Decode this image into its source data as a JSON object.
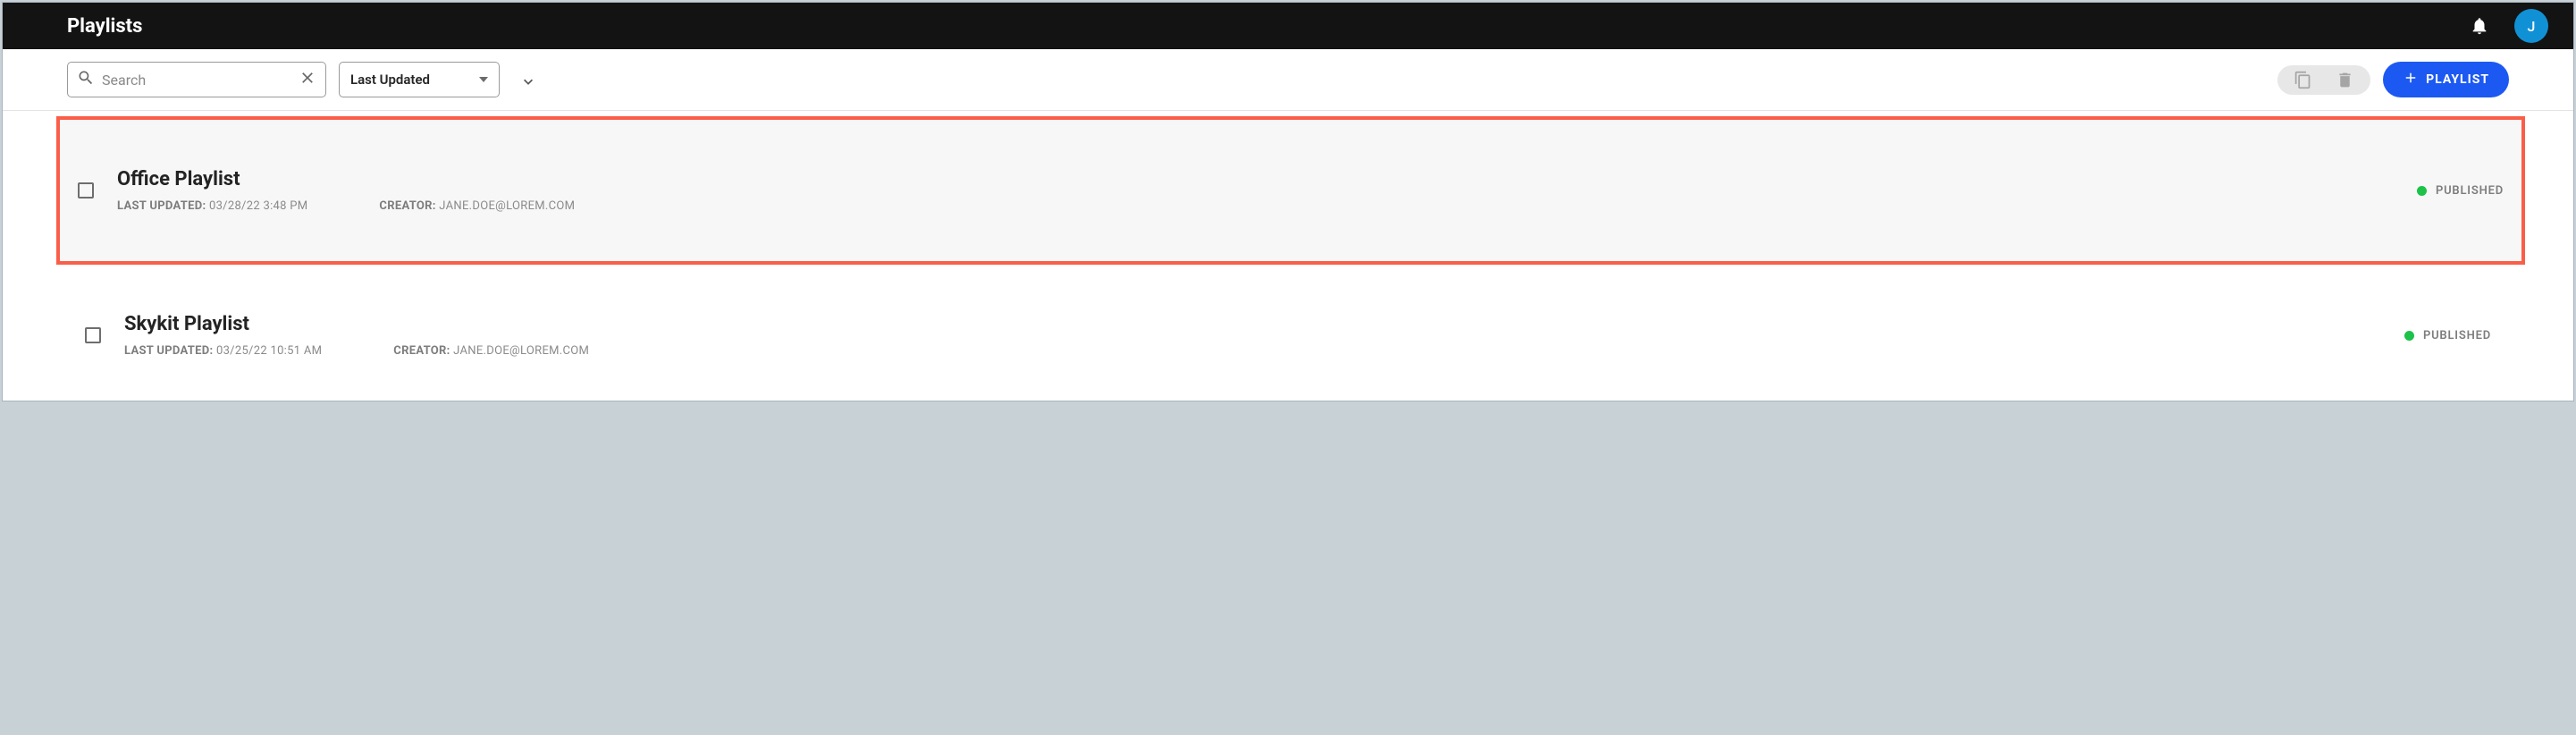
{
  "header": {
    "title": "Playlists",
    "avatar_initial": "J"
  },
  "toolbar": {
    "search_placeholder": "Search",
    "sort_label": "Last Updated",
    "new_playlist_label": "PLAYLIST"
  },
  "playlists": [
    {
      "title": "Office Playlist",
      "last_updated_label": "LAST UPDATED:",
      "last_updated_value": "03/28/22 3:48 PM",
      "creator_label": "CREATOR:",
      "creator_value": "JANE.DOE@LOREM.COM",
      "status": "PUBLISHED",
      "highlighted": true
    },
    {
      "title": "Skykit Playlist",
      "last_updated_label": "LAST UPDATED:",
      "last_updated_value": "03/25/22 10:51 AM",
      "creator_label": "CREATOR:",
      "creator_value": "JANE.DOE@LOREM.COM",
      "status": "PUBLISHED",
      "highlighted": false
    }
  ]
}
